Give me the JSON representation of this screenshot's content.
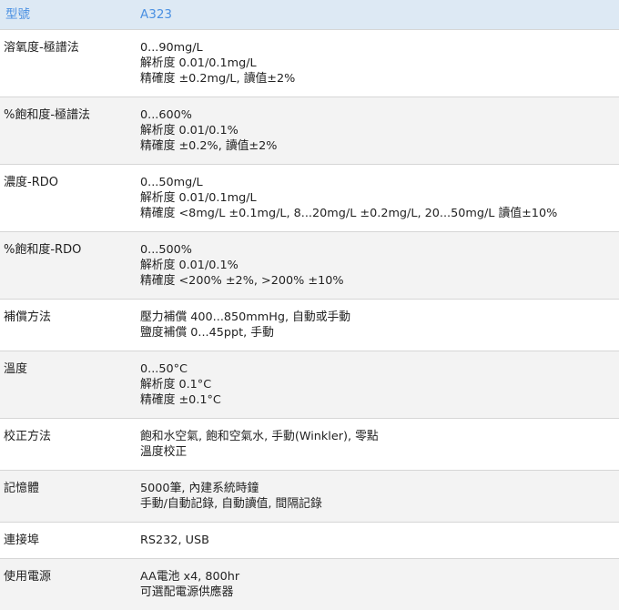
{
  "header": {
    "label": "型號",
    "model": "A323"
  },
  "rows": [
    {
      "label": "溶氧度-極譜法",
      "lines": [
        "0...90mg/L",
        "解析度 0.01/0.1mg/L",
        "精確度 ±0.2mg/L, 讀值±2%"
      ]
    },
    {
      "label": "%飽和度-極譜法",
      "lines": [
        "0...600%",
        "解析度 0.01/0.1%",
        "精確度 ±0.2%, 讀值±2%"
      ]
    },
    {
      "label": "濃度-RDO",
      "lines": [
        "0...50mg/L",
        "解析度 0.01/0.1mg/L",
        "精確度 <8mg/L ±0.1mg/L, 8...20mg/L ±0.2mg/L, 20...50mg/L 讀值±10%"
      ]
    },
    {
      "label": "%飽和度-RDO",
      "lines": [
        "0...500%",
        "解析度 0.01/0.1%",
        "精確度 <200% ±2%, >200% ±10%"
      ]
    },
    {
      "label": "補償方法",
      "lines": [
        "壓力補償 400...850mmHg, 自動或手動",
        "鹽度補償 0...45ppt, 手動"
      ]
    },
    {
      "label": "溫度",
      "lines": [
        "0...50°C",
        "解析度 0.1°C",
        "精確度 ±0.1°C"
      ]
    },
    {
      "label": "校正方法",
      "lines": [
        "飽和水空氣, 飽和空氣水, 手動(Winkler), 零點",
        "溫度校正"
      ]
    },
    {
      "label": "記憶體",
      "lines": [
        "5000筆, 內建系統時鐘",
        "手動/自動記錄, 自動讀值, 間隔記錄"
      ]
    },
    {
      "label": "連接埠",
      "lines": [
        "RS232, USB"
      ]
    },
    {
      "label": "使用電源",
      "lines": [
        "AA電池 x4, 800hr",
        "可選配電源供應器"
      ]
    }
  ]
}
